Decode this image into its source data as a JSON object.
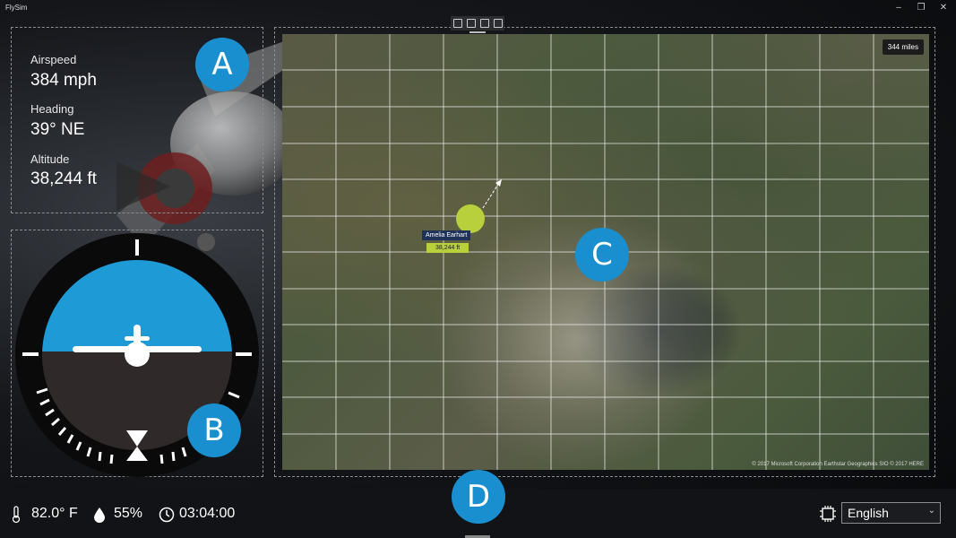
{
  "app": {
    "title": "FlySim",
    "window_controls": [
      "minimize-icon",
      "restore-icon",
      "close-icon"
    ]
  },
  "toolbar": {
    "icons": [
      "edit-icon",
      "comment-icon",
      "frame-icon",
      "picture-icon"
    ]
  },
  "stats": {
    "airspeed_label": "Airspeed",
    "airspeed_value": "384 mph",
    "heading_label": "Heading",
    "heading_value": "39° NE",
    "altitude_label": "Altitude",
    "altitude_value": "38,244 ft"
  },
  "callouts": {
    "a": "A",
    "b": "B",
    "c": "C",
    "d": "D"
  },
  "map": {
    "scale": "344 miles",
    "copyright": "© 2017 Microsoft Corporation  Earthstar Geographics  SIO  © 2017 HERE",
    "pilot_name": "Amelia Earhart",
    "pilot_altitude": "38,244 ft"
  },
  "footer": {
    "temperature": "82.0° F",
    "humidity": "55%",
    "time": "03:04:00",
    "language": "English"
  },
  "colors": {
    "accent": "#1a8fd0",
    "sky": "#1e9ad6",
    "ground": "#2f2a29",
    "marker": "#b8d03c"
  }
}
